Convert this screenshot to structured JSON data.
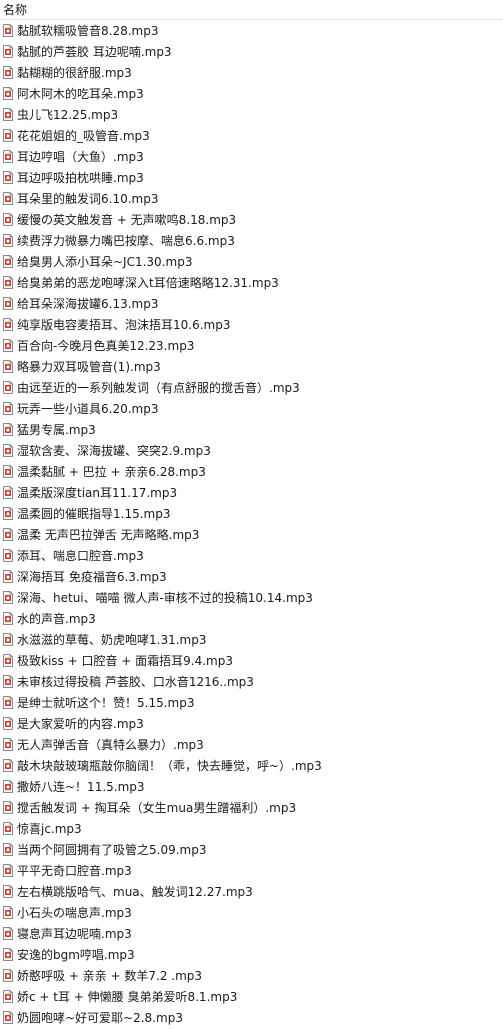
{
  "header": {
    "name_column": "名称"
  },
  "file_icon": "audio-file-icon",
  "files": [
    "黏腻软糯吸管音8.28.mp3",
    "黏腻的芦荟胶 耳边呢喃.mp3",
    "黏糊糊的很舒服.mp3",
    "阿木阿木的吃耳朵.mp3",
    "虫儿飞12.25.mp3",
    "花花姐姐的_吸管音.mp3",
    "耳边哼唱（大鱼）.mp3",
    "耳边呼吸拍枕哄睡.mp3",
    "耳朵里的触发词6.10.mp3",
    "缓慢の英文触发音 + 无声嗽鸣8.18.mp3",
    "续费浮力微暴力嘴巴按摩、喘息6.6.mp3",
    "给臭男人添小耳朵~JC1.30.mp3",
    "给臭弟弟的恶龙咆哮深入t耳倍速略略12.31.mp3",
    "给耳朵深海拔罐6.13.mp3",
    "纯享版电容麦捂耳、泡沫捂耳10.6.mp3",
    "百合向-今晚月色真美12.23.mp3",
    "略暴力双耳吸管音(1).mp3",
    "由远至近的一系列触发词（有点舒服的搅舌音）.mp3",
    "玩弄一些小道具6.20.mp3",
    "猛男专属.mp3",
    "湿软含麦、深海拔罐、突突2.9.mp3",
    "温柔黏腻 + 巴拉 + 亲亲6.28.mp3",
    "温柔版深度tian耳11.17.mp3",
    "温柔圆的催眠指导1.15.mp3",
    "温柔 无声巴拉弹舌 无声略略.mp3",
    "添耳、喘息口腔音.mp3",
    "深海捂耳 免疫福音6.3.mp3",
    "深海、hetui、喵喵 微人声-审核不过的投稿10.14.mp3",
    "水的声音.mp3",
    "水滋滋的草莓、奶虎咆哮1.31.mp3",
    "极致kiss + 口腔音 + 面霜捂耳9.4.mp3",
    "未审核过得投稿 芦荟胶、口水音1216..mp3",
    "是绅士就听这个！赞！5.15.mp3",
    "是大家爱听的内容.mp3",
    "无人声弹舌音（真特么暴力）.mp3",
    "敲木块敲玻璃瓶敲你脑阔！（乖，快去睡觉，呼~）.mp3",
    "撒娇八连~！11.5.mp3",
    "搅舌触发词 + 掏耳朵（女生mua男生蹭福利）.mp3",
    "惊喜jc.mp3",
    "当两个阿圆拥有了吸管之5.09.mp3",
    "平平无奇口腔音.mp3",
    "左右横跳版哈气、mua、触发词12.27.mp3",
    "小石头の喘息声.mp3",
    "寝息声耳边呢喃.mp3",
    "安逸的bgm哼唱.mp3",
    "娇憨呼吸 + 亲亲 + 数羊7.2 .mp3",
    "娇c + t耳 + 伸懒腰 臭弟弟爱听8.1.mp3",
    "奶圆咆哮~好可爱耶~2.8.mp3"
  ]
}
